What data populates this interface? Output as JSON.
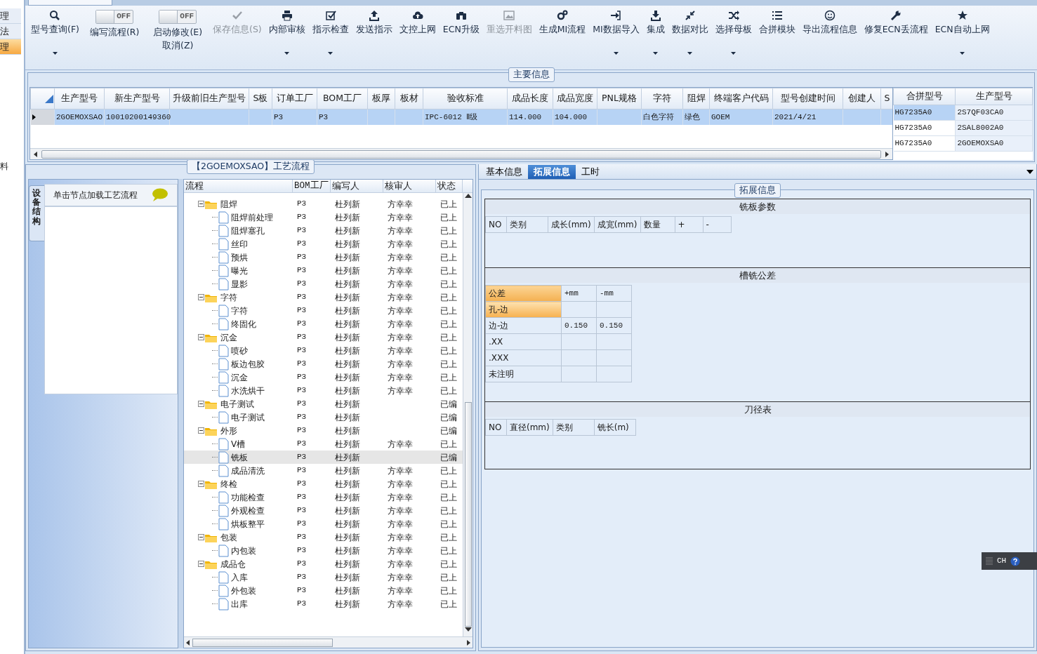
{
  "left_nav": {
    "items": [
      {
        "label": "理",
        "selected": false
      },
      {
        "label": "法",
        "selected": false
      },
      {
        "label": "理",
        "selected": true
      }
    ],
    "lower_labels": [
      "料"
    ]
  },
  "toolbar": [
    {
      "kind": "button",
      "label": "型号查询(F)",
      "dropdown": true,
      "disabled": false
    },
    {
      "kind": "toggle",
      "switch": "OFF",
      "label": "编写流程(R)",
      "on": false
    },
    {
      "kind": "toggle",
      "switch": "OFF",
      "label": "启动修改(E)",
      "label2": "取消(Z)",
      "on": false
    },
    {
      "kind": "button",
      "label": "保存信息(S)",
      "dropdown": false,
      "disabled": true
    },
    {
      "kind": "button",
      "label": "内部审核",
      "dropdown": true,
      "disabled": false
    },
    {
      "kind": "button",
      "label": "指示检查",
      "dropdown": true,
      "disabled": false
    },
    {
      "kind": "button",
      "label": "发送指示",
      "dropdown": false,
      "disabled": false
    },
    {
      "kind": "button",
      "label": "文控上网",
      "dropdown": false,
      "disabled": false
    },
    {
      "kind": "button",
      "label": "ECN升级",
      "dropdown": false,
      "disabled": false
    },
    {
      "kind": "button",
      "label": "重选开料图",
      "dropdown": false,
      "disabled": true
    },
    {
      "kind": "button",
      "label": "生成MI流程",
      "dropdown": false,
      "disabled": false
    },
    {
      "kind": "button",
      "label": "MI数据导入",
      "dropdown": true,
      "disabled": false
    },
    {
      "kind": "button",
      "label": "集成",
      "dropdown": true,
      "disabled": false
    },
    {
      "kind": "button",
      "label": "数据对比",
      "dropdown": true,
      "disabled": false
    },
    {
      "kind": "button",
      "label": "选择母板",
      "dropdown": true,
      "disabled": false
    },
    {
      "kind": "button",
      "label": "合拼模块",
      "dropdown": false,
      "disabled": false
    },
    {
      "kind": "button",
      "label": "导出流程信息",
      "dropdown": false,
      "disabled": false
    },
    {
      "kind": "button",
      "label": "修复ECN丢流程",
      "dropdown": false,
      "disabled": false
    },
    {
      "kind": "button",
      "label": "ECN自动上网",
      "dropdown": true,
      "disabled": false
    }
  ],
  "main_info": {
    "caption": "主要信息",
    "columns": [
      "生产型号",
      "新生产型号",
      "升级前旧生产型号",
      "S板",
      "订单工厂",
      "BOM工厂",
      "板厚",
      "板材",
      "验收标准",
      "成品长度",
      "成品宽度",
      "PNL规格",
      "字符",
      "阻焊",
      "终端客户代码",
      "型号创建时间",
      "创建人",
      "S"
    ],
    "rows": [
      {
        "selected": true,
        "cells": [
          "2GOEMOXSAO",
          "10010200149360",
          "",
          "",
          "P3",
          "P3",
          "",
          "",
          "IPC-6012 Ⅱ级",
          "114.000",
          "104.000",
          "",
          "白色字符",
          "绿色",
          "GOEM",
          "2021/4/21",
          "",
          ""
        ]
      }
    ],
    "side_table": {
      "columns": [
        "合拼型号",
        "生产型号"
      ],
      "rows": [
        {
          "cells": [
            "HG7235A0",
            "2S7QF03CA0"
          ],
          "selected": true
        },
        {
          "cells": [
            "HG7235A0",
            "2SAL8002A0"
          ],
          "selected": false
        },
        {
          "cells": [
            "HG7235A0",
            "2GOEMOXSA0"
          ],
          "selected": false
        }
      ]
    }
  },
  "process": {
    "caption": "【2GOEMOXSAO】工艺流程",
    "side_tab": "设备结构",
    "hint": "单击节点加载工艺流程",
    "columns": [
      "流程",
      "BOM工厂",
      "编写人",
      "核审人",
      "状态"
    ],
    "tree": [
      {
        "name": "阻焊",
        "bom": "P3",
        "writer": "杜列新",
        "reviewer": "方幸幸",
        "status": "已上",
        "expanded": true,
        "selected": false,
        "children": [
          {
            "name": "阻焊前处理",
            "bom": "P3",
            "writer": "杜列新",
            "reviewer": "方幸幸",
            "status": "已上",
            "selected": false
          },
          {
            "name": "阻焊塞孔",
            "bom": "P3",
            "writer": "杜列新",
            "reviewer": "方幸幸",
            "status": "已上",
            "selected": false
          },
          {
            "name": "丝印",
            "bom": "P3",
            "writer": "杜列新",
            "reviewer": "方幸幸",
            "status": "已上",
            "selected": false
          },
          {
            "name": "预烘",
            "bom": "P3",
            "writer": "杜列新",
            "reviewer": "方幸幸",
            "status": "已上",
            "selected": false
          },
          {
            "name": "曝光",
            "bom": "P3",
            "writer": "杜列新",
            "reviewer": "方幸幸",
            "status": "已上",
            "selected": false
          },
          {
            "name": "显影",
            "bom": "P3",
            "writer": "杜列新",
            "reviewer": "方幸幸",
            "status": "已上",
            "selected": false
          }
        ]
      },
      {
        "name": "字符",
        "bom": "P3",
        "writer": "杜列新",
        "reviewer": "方幸幸",
        "status": "已上",
        "expanded": true,
        "selected": false,
        "children": [
          {
            "name": "字符",
            "bom": "P3",
            "writer": "杜列新",
            "reviewer": "方幸幸",
            "status": "已上",
            "selected": false
          },
          {
            "name": "终固化",
            "bom": "P3",
            "writer": "杜列新",
            "reviewer": "方幸幸",
            "status": "已上",
            "selected": false
          }
        ]
      },
      {
        "name": "沉金",
        "bom": "P3",
        "writer": "杜列新",
        "reviewer": "方幸幸",
        "status": "已上",
        "expanded": true,
        "selected": false,
        "children": [
          {
            "name": "喷砂",
            "bom": "P3",
            "writer": "杜列新",
            "reviewer": "方幸幸",
            "status": "已上",
            "selected": false
          },
          {
            "name": "板边包胶",
            "bom": "P3",
            "writer": "杜列新",
            "reviewer": "方幸幸",
            "status": "已上",
            "selected": false
          },
          {
            "name": "沉金",
            "bom": "P3",
            "writer": "杜列新",
            "reviewer": "方幸幸",
            "status": "已上",
            "selected": false
          },
          {
            "name": "水洗烘干",
            "bom": "P3",
            "writer": "杜列新",
            "reviewer": "方幸幸",
            "status": "已上",
            "selected": false
          }
        ]
      },
      {
        "name": "电子测试",
        "bom": "P3",
        "writer": "杜列新",
        "status": "已编",
        "expanded": true,
        "selected": false,
        "children": [
          {
            "name": "电子测试",
            "bom": "P3",
            "writer": "杜列新",
            "status": "已编",
            "selected": false
          }
        ]
      },
      {
        "name": "外形",
        "bom": "P3",
        "writer": "杜列新",
        "status": "已编",
        "expanded": true,
        "selected": false,
        "children": [
          {
            "name": "V槽",
            "bom": "P3",
            "writer": "杜列新",
            "reviewer": "方幸幸",
            "status": "已上",
            "selected": false
          },
          {
            "name": "铣板",
            "bom": "P3",
            "writer": "杜列新",
            "status": "已编",
            "selected": true
          },
          {
            "name": "成品清洗",
            "bom": "P3",
            "writer": "杜列新",
            "reviewer": "方幸幸",
            "status": "已上",
            "selected": false
          }
        ]
      },
      {
        "name": "终检",
        "bom": "P3",
        "writer": "杜列新",
        "reviewer": "方幸幸",
        "status": "已上",
        "expanded": true,
        "selected": false,
        "children": [
          {
            "name": "功能检查",
            "bom": "P3",
            "writer": "杜列新",
            "reviewer": "方幸幸",
            "status": "已上",
            "selected": false
          },
          {
            "name": "外观检查",
            "bom": "P3",
            "writer": "杜列新",
            "reviewer": "方幸幸",
            "status": "已上",
            "selected": false
          },
          {
            "name": "烘板整平",
            "bom": "P3",
            "writer": "杜列新",
            "reviewer": "方幸幸",
            "status": "已上",
            "selected": false
          }
        ]
      },
      {
        "name": "包装",
        "bom": "P3",
        "writer": "杜列新",
        "reviewer": "方幸幸",
        "status": "已上",
        "expanded": true,
        "selected": false,
        "children": [
          {
            "name": "内包装",
            "bom": "P3",
            "writer": "杜列新",
            "reviewer": "方幸幸",
            "status": "已上",
            "selected": false
          }
        ]
      },
      {
        "name": "成品仓",
        "bom": "P3",
        "writer": "杜列新",
        "reviewer": "方幸幸",
        "status": "已上",
        "expanded": true,
        "selected": false,
        "children": [
          {
            "name": "入库",
            "bom": "P3",
            "writer": "杜列新",
            "reviewer": "方幸幸",
            "status": "已上",
            "selected": false
          },
          {
            "name": "外包装",
            "bom": "P3",
            "writer": "杜列新",
            "reviewer": "方幸幸",
            "status": "已上",
            "selected": false
          },
          {
            "name": "出库",
            "bom": "P3",
            "writer": "杜列新",
            "reviewer": "方幸幸",
            "status": "已上",
            "selected": false
          }
        ]
      }
    ]
  },
  "detail": {
    "tabs": [
      {
        "label": "基本信息",
        "selected": false
      },
      {
        "label": "拓展信息",
        "selected": true
      },
      {
        "label": "工时",
        "selected": false
      }
    ],
    "caption": "拓展信息",
    "milling": {
      "title": "铣板参数",
      "columns": [
        "NO",
        "类别",
        "成长(mm)",
        "成宽(mm)",
        "数量",
        "+",
        "-"
      ]
    },
    "tolerance": {
      "title": "槽铣公差",
      "columns": [
        "公差",
        "+mm",
        "-mm"
      ],
      "rows": [
        {
          "cells": [
            "孔-边",
            "",
            ""
          ],
          "selected": true
        },
        {
          "cells": [
            "边-边",
            "0.150",
            "0.150"
          ],
          "selected": false
        },
        {
          "cells": [
            ".XX",
            "",
            ""
          ],
          "selected": false
        },
        {
          "cells": [
            ".XXX",
            "",
            ""
          ],
          "selected": false
        },
        {
          "cells": [
            "未注明",
            "",
            ""
          ],
          "selected": false
        }
      ]
    },
    "tools": {
      "title": "刀径表",
      "columns": [
        "NO",
        "直径(mm)",
        "类别",
        "铣长(m)"
      ]
    }
  },
  "language_bar": {
    "label": "CH"
  }
}
